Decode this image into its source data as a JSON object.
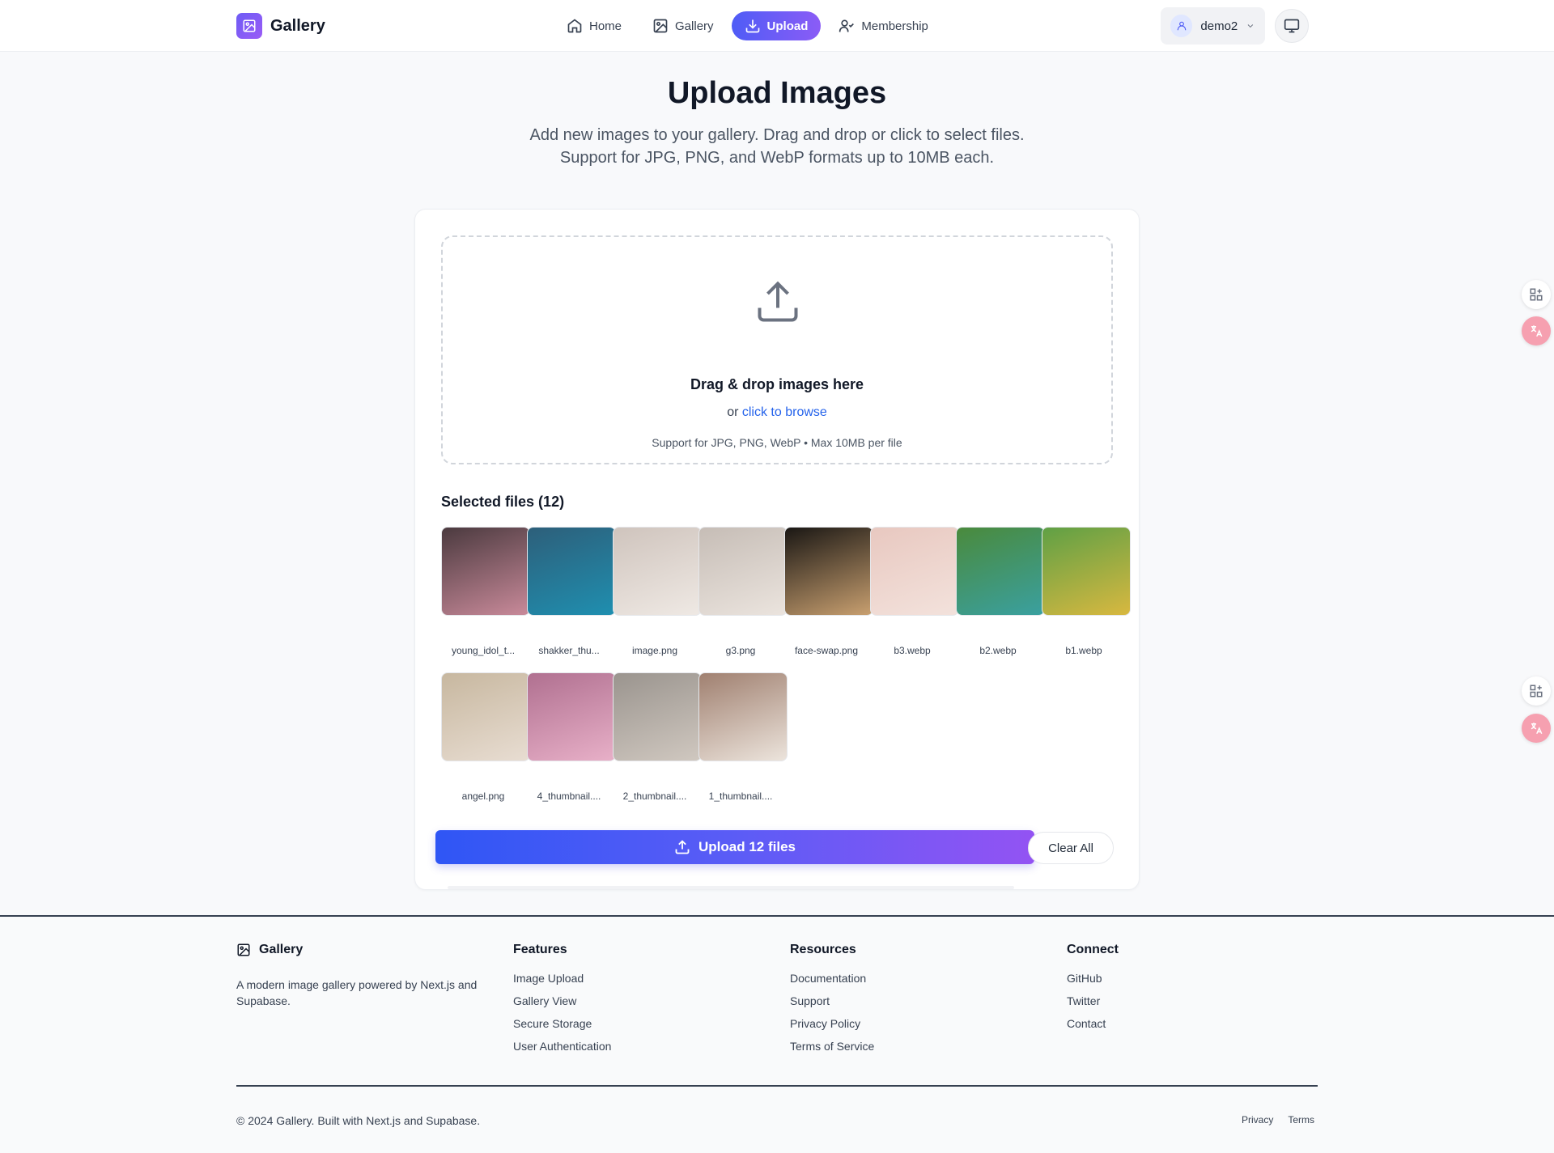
{
  "header": {
    "brand": "Gallery",
    "nav": [
      {
        "label": "Home",
        "icon": "home-icon"
      },
      {
        "label": "Gallery",
        "icon": "image-icon"
      },
      {
        "label": "Upload",
        "icon": "download-icon",
        "active": true
      },
      {
        "label": "Membership",
        "icon": "user-check-icon"
      }
    ],
    "username": "demo2"
  },
  "hero": {
    "title": "Upload Images",
    "subtitle_line1": "Add new images to your gallery. Drag and drop or click to select files.",
    "subtitle_line2": "Support for JPG, PNG, and WebP formats up to 10MB each."
  },
  "dropzone": {
    "title": "Drag & drop images here",
    "or_text": "or",
    "browse_link": "click to browse",
    "note": "Support for JPG, PNG, WebP • Max 10MB per file"
  },
  "selected": {
    "title": "Selected files (12)",
    "files": [
      {
        "name": "young_idol_t...",
        "colors": [
          "#4b3a3f",
          "#c98a9a"
        ]
      },
      {
        "name": "shakker_thu...",
        "colors": [
          "#2d5f7a",
          "#1f8fb0"
        ]
      },
      {
        "name": "image.png",
        "colors": [
          "#cfc4bd",
          "#efe9e4"
        ]
      },
      {
        "name": "g3.png",
        "colors": [
          "#c6bdb6",
          "#ebe4de"
        ]
      },
      {
        "name": "face-swap.png",
        "colors": [
          "#1a1714",
          "#c9a070"
        ]
      },
      {
        "name": "b3.webp",
        "colors": [
          "#e8c8c0",
          "#f3e2dc"
        ]
      },
      {
        "name": "b2.webp",
        "colors": [
          "#4a8a3c",
          "#3aa0a0"
        ]
      },
      {
        "name": "b1.webp",
        "colors": [
          "#5fa045",
          "#d8b840"
        ]
      },
      {
        "name": "angel.png",
        "colors": [
          "#c7b79f",
          "#e8ddd2"
        ]
      },
      {
        "name": "4_thumbnail....",
        "colors": [
          "#b07090",
          "#e8b0c8"
        ]
      },
      {
        "name": "2_thumbnail....",
        "colors": [
          "#9a948e",
          "#d0c8c0"
        ]
      },
      {
        "name": "1_thumbnail....",
        "colors": [
          "#a08070",
          "#ece4dc"
        ]
      }
    ]
  },
  "actions": {
    "upload_label": "Upload 12 files",
    "clear_label": "Clear All"
  },
  "footer": {
    "brand": "Gallery",
    "description": "A modern image gallery powered by Next.js and Supabase.",
    "columns": [
      {
        "title": "Features",
        "links": [
          "Image Upload",
          "Gallery View",
          "Secure Storage",
          "User Authentication"
        ]
      },
      {
        "title": "Resources",
        "links": [
          "Documentation",
          "Support",
          "Privacy Policy",
          "Terms of Service"
        ]
      },
      {
        "title": "Connect",
        "links": [
          "GitHub",
          "Twitter",
          "Contact"
        ]
      }
    ],
    "copyright": "© 2024 Gallery. Built with Next.js and Supabase.",
    "legal": [
      "Privacy",
      "Terms"
    ]
  }
}
